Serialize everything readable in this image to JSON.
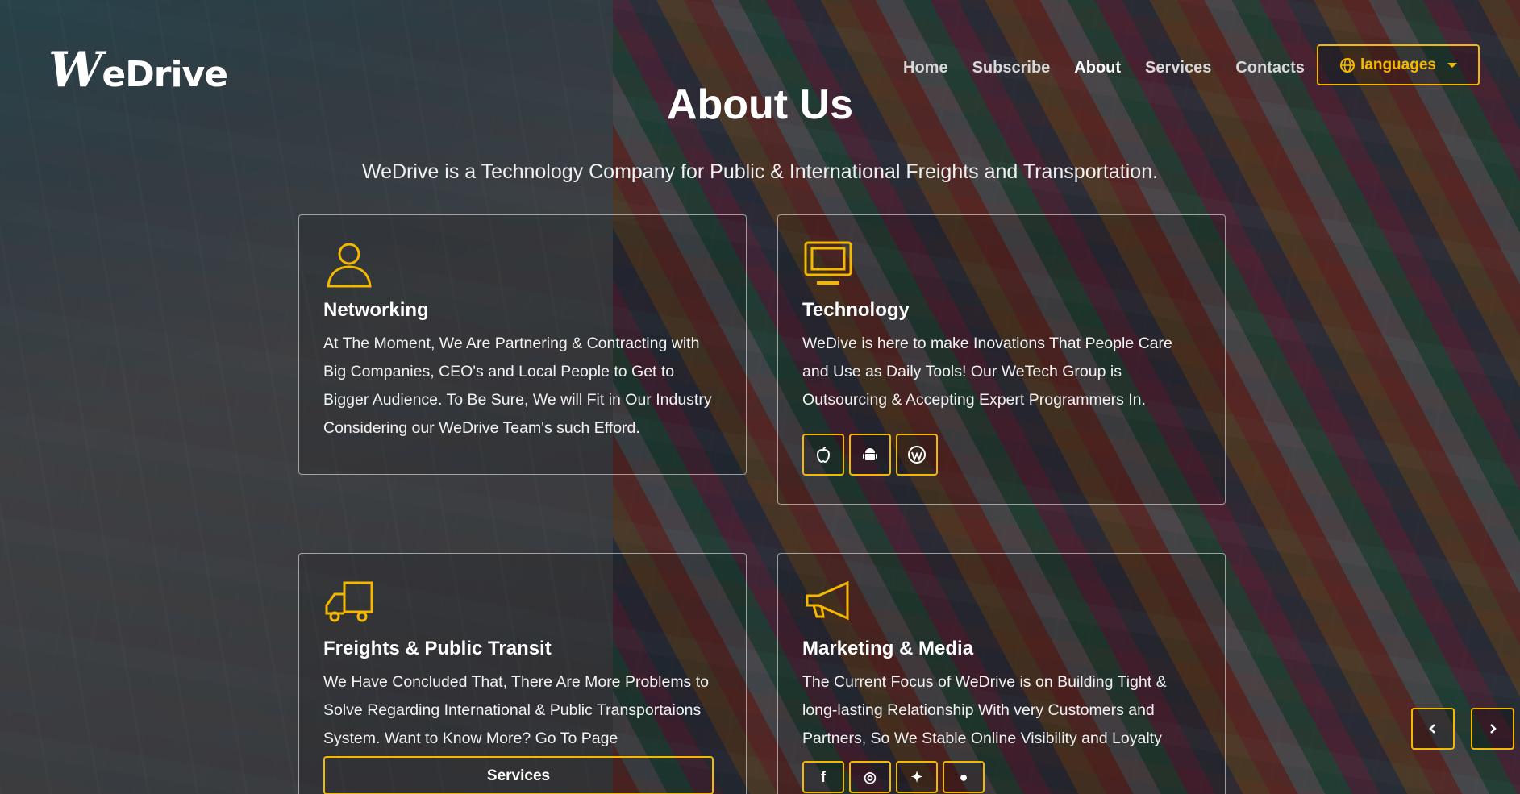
{
  "brand": {
    "logo_initial": "W",
    "logo_rest": "eDrive"
  },
  "nav": {
    "items": [
      {
        "label": "Home"
      },
      {
        "label": "Subscribe"
      },
      {
        "label": "About"
      },
      {
        "label": "Services"
      },
      {
        "label": "Contacts"
      }
    ],
    "active": "About",
    "languages_label": "languages"
  },
  "hero": {
    "title": "About Us",
    "subtitle": "WeDrive is a Technology Company for Public & International Freights and Transportation."
  },
  "cards": [
    {
      "icon": "person-icon",
      "title": "Networking",
      "text": "At The Moment, We Are Partnering & Contracting with Big Companies, CEO's and Local People to Get to Bigger Audience. To Be Sure, We will Fit in Our Industry Considering our WeDrive Team's such Efford."
    },
    {
      "icon": "monitor-icon",
      "title": "Technology",
      "text": "WeDive is here to make Inovations That People Care and Use as Daily Tools! Our WeTech Group is Outsourcing & Accepting Expert Programmers In.",
      "buttons": [
        "apple-icon",
        "android-icon",
        "wordpress-icon"
      ]
    },
    {
      "icon": "truck-icon",
      "title": "Freights & Public Transit",
      "text": "We Have Concluded That, There Are More Problems to Solve Regarding International & Public Transportaions System. Want to Know More? Go To Page",
      "button_label": "Services"
    },
    {
      "icon": "megaphone-icon",
      "title": "Marketing & Media",
      "text": "The Current Focus of WeDrive is on Building Tight & long-lasting Relationship With very Customers and Partners, So We Stable Online Visibility and Loyalty",
      "buttons": [
        "facebook-icon",
        "instagram-icon",
        "twitter-icon",
        "chat-icon"
      ]
    }
  ],
  "colors": {
    "accent": "#f5b800",
    "text": "#ffffff"
  }
}
